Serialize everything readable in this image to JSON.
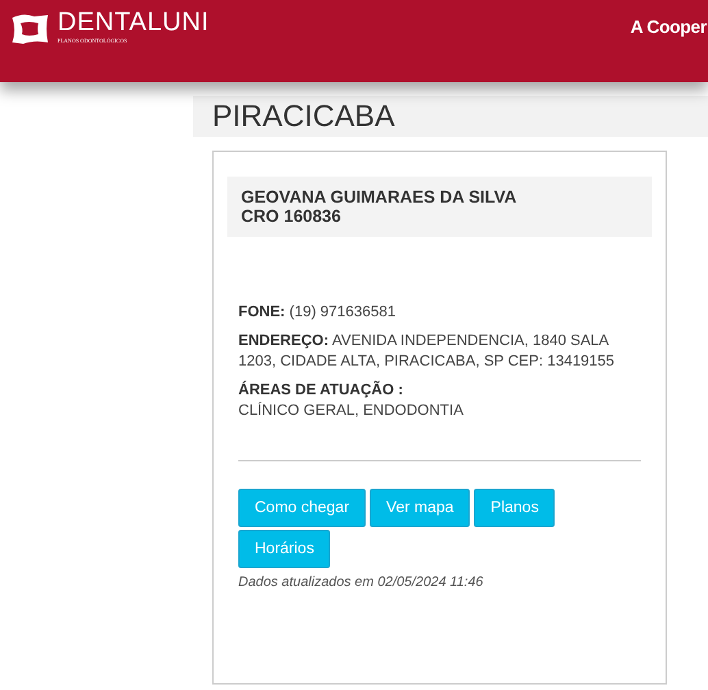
{
  "header": {
    "brand": "DENTALUNI",
    "tagline": "PLANOS ODONTOLÓGICOS",
    "nav_text": "A Cooper"
  },
  "city": "PIRACICABA",
  "dentist": {
    "name": "GEOVANA GUIMARAES DA SILVA",
    "cro": "CRO 160836"
  },
  "details": [
    {
      "kind": "inline",
      "text": "**FONE:** (19) 971636581"
    },
    {
      "kind": "inline",
      "text": "**ENDEREÇO:** AVENIDA INDEPENDENCIA, 1840 SALA 1203, CIDADE ALTA, PIRACICABA, SP CEP: 13419155"
    },
    {
      "kind": "block",
      "label": "ÁREAS DE ATUAÇÃO :",
      "text": "CLÍNICO GERAL, ENDODONTIA"
    }
  ],
  "buttons": [
    "Como chegar",
    "Ver mapa",
    "Planos",
    "Horários"
  ],
  "updated": "Dados atualizados em 02/05/2024 11:46"
}
